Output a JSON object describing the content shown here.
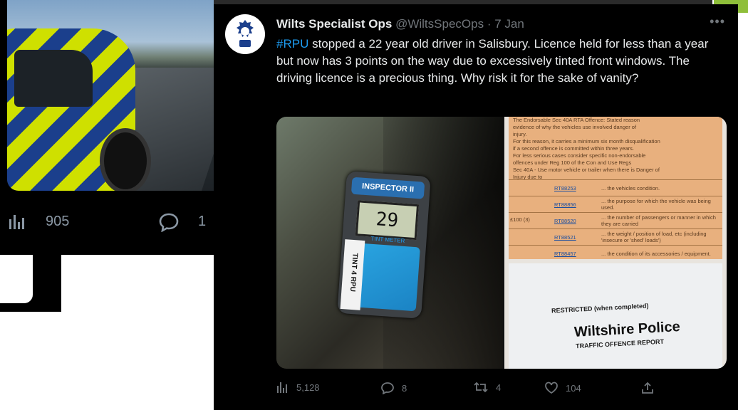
{
  "background_tweet": {
    "views": "905",
    "replies": "1"
  },
  "tweet": {
    "author_name": "Wilts Specialist Ops",
    "author_handle": "@WiltsSpecOps",
    "separator": "·",
    "date": "7 Jan",
    "more_label": "•••",
    "hashtag": "#RPU",
    "body": " stopped a 22 year old driver in Salisbury. Licence held for less than a year but now has 3 points on the way due to excessively tinted front windows. The driving licence is a precious thing. Why risk it for the sake of vanity?",
    "media": {
      "meter_brand": "INSPECTOR II",
      "meter_reading": "29",
      "meter_sub": "TINT METER",
      "meter_label": "TINT 4 RPU",
      "doc_lines": [
        "The Endorsable Sec 40A RTA Offence: Stated reason",
        "evidence of why the vehicles use involved danger of",
        "injury.",
        "For this reason, it carries a minimum six month disqualification",
        "if a second offence is committed within three years.",
        "For less serious cases consider specific non-endorsable",
        "offences under Reg 100 of the Con and Use Regs",
        "Sec 40A - Use motor vehicle or trailer when there is Danger of",
        "Injury due to"
      ],
      "doc_fine": "£100 (3)",
      "doc_rows": [
        {
          "code": "RT88253",
          "desc": "... the vehicles condition."
        },
        {
          "code": "RT88856",
          "desc": "... the purpose for which the vehicle was being used."
        },
        {
          "code": "RT88520",
          "desc": "... the number of passengers or manner in which they are carried"
        },
        {
          "code": "RT88521",
          "desc": "... the weight / position of load, etc (including 'insecure or 'shed' loads')"
        },
        {
          "code": "RT88457",
          "desc": "... the condition of its accessories / equipment."
        }
      ],
      "restricted": "RESTRICTED (when completed)",
      "police_title": "Wiltshire Police",
      "report_title": "TRAFFIC OFFENCE REPORT"
    },
    "stats": {
      "views": "5,128",
      "replies": "8",
      "retweets": "4",
      "likes": "104"
    }
  }
}
